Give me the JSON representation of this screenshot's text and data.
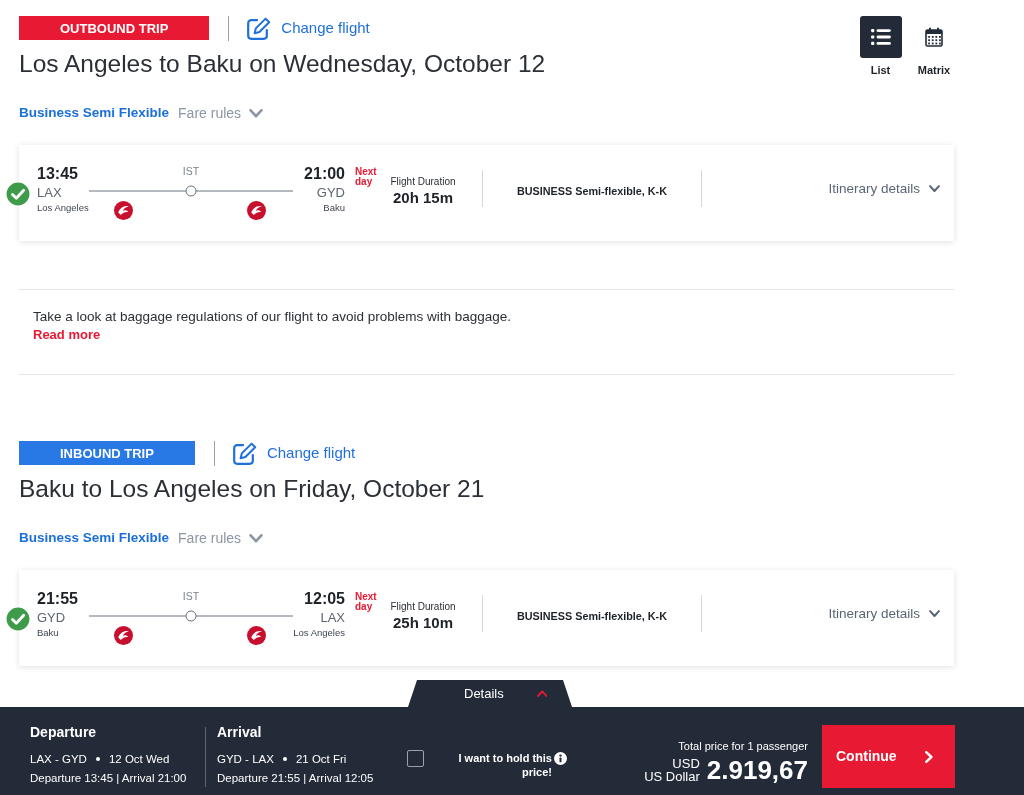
{
  "view_toggle": [
    {
      "label": "List",
      "kind": "list",
      "selected": true
    },
    {
      "label": "Matrix",
      "kind": "matrix",
      "selected": false
    }
  ],
  "trips": [
    {
      "tag": "OUTBOUND TRIP",
      "color": "#e81932",
      "change_link": "Change flight",
      "title": "Los Angeles to Baku on Wednesday, October 12",
      "fare_class": "Business Semi Flexible",
      "fare_rules": "Fare rules",
      "flight": {
        "selected": true,
        "departure": {
          "time": "13:45",
          "code": "LAX",
          "city": "Los Angeles"
        },
        "stop": "IST",
        "arrival": {
          "time": "21:00",
          "code": "GYD",
          "city": "Baku"
        },
        "next_day": "Next day",
        "duration_label": "Flight Duration",
        "duration": "20h 15m",
        "cabin": "BUSINESS Semi-flexible, K-K",
        "details_link": "Itinerary details"
      },
      "notice": {
        "text": "Take a look at baggage regulations of our flight to avoid problems with baggage.",
        "link": "Read more"
      }
    },
    {
      "tag": "INBOUND TRIP",
      "color": "#2878e6",
      "change_link": "Change flight",
      "title": "Baku to Los Angeles on Friday, October 21",
      "fare_class": "Business Semi Flexible",
      "fare_rules": "Fare rules",
      "flight": {
        "selected": true,
        "departure": {
          "time": "21:55",
          "code": "GYD",
          "city": "Baku"
        },
        "stop": "IST",
        "arrival": {
          "time": "12:05",
          "code": "LAX",
          "city": "Los Angeles"
        },
        "next_day": "Next day",
        "duration_label": "Flight Duration",
        "duration": "25h 10m",
        "cabin": "BUSINESS Semi-flexible, K-K",
        "details_link": "Itinerary details"
      }
    }
  ],
  "summary": {
    "tab": "Details",
    "legs": [
      {
        "heading": "Departure",
        "route": "LAX - GYD",
        "date": "12 Oct Wed",
        "times": "Departure 13:45 | Arrival 21:00"
      },
      {
        "heading": "Arrival",
        "route": "GYD - LAX",
        "date": "21 Oct Fri",
        "times": "Departure 21:55 | Arrival 12:05"
      }
    ],
    "hold": {
      "checked": false,
      "label": "I want to hold this price!"
    },
    "price_label": "Total price for 1 passenger",
    "currency_code": "USD",
    "currency_name": "US Dollar",
    "amount": "2.919,67",
    "continue": "Continue"
  }
}
